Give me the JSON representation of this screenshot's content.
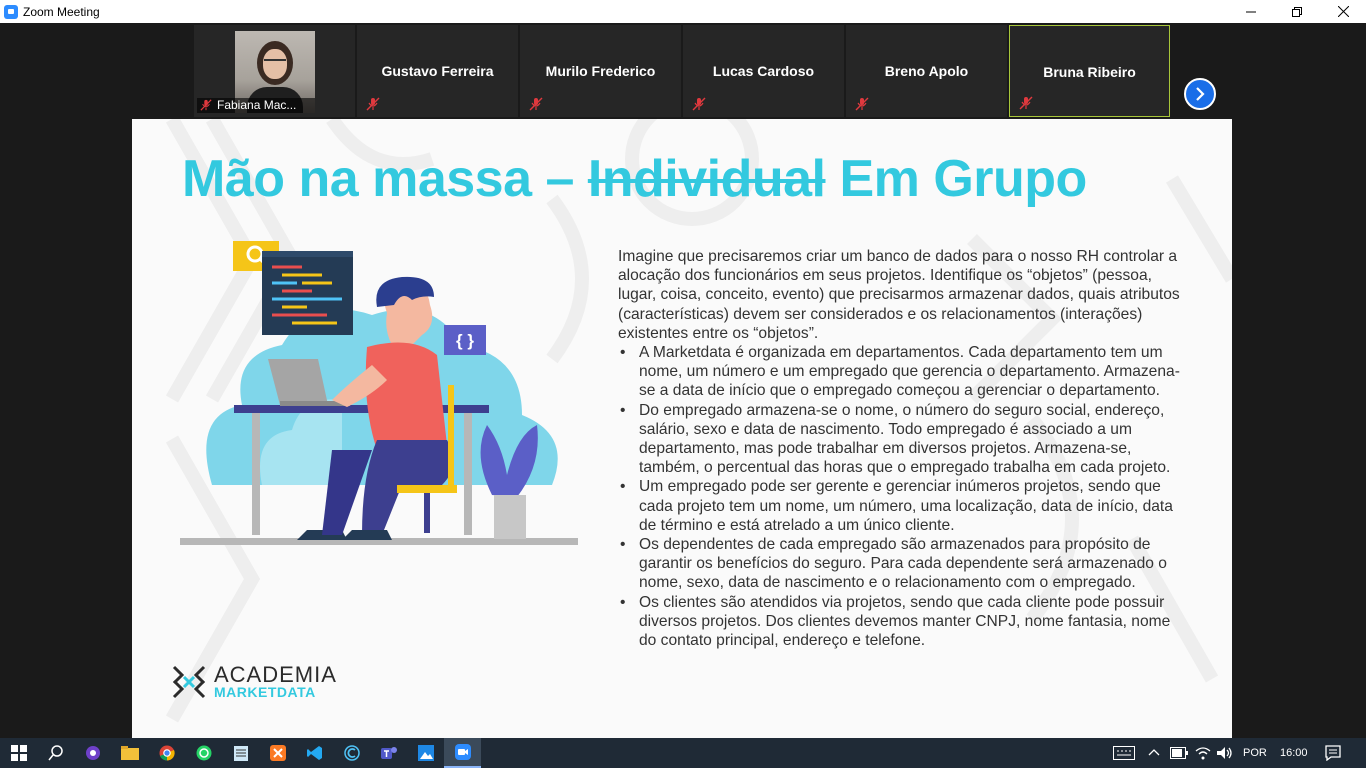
{
  "window": {
    "title": "Zoom Meeting"
  },
  "participants": [
    {
      "name": "Fabiana Mac...",
      "type": "video"
    },
    {
      "name": "Gustavo Ferreira"
    },
    {
      "name": "Murilo Frederico"
    },
    {
      "name": "Lucas Cardoso"
    },
    {
      "name": "Breno Apolo"
    },
    {
      "name": "Bruna Ribeiro",
      "active": true
    }
  ],
  "slide": {
    "title_part1": "Mão na massa – ",
    "title_struck": "Individual",
    "title_part2": " Em Grupo",
    "intro": "Imagine que precisaremos criar um banco de dados para o nosso RH controlar a alocação dos funcionários em seus projetos. Identifique os “objetos” (pessoa, lugar, coisa, conceito, evento) que precisarmos armazenar dados, quais atributos  (características) devem ser considerados e os relacionamentos (interações) existentes entre os “objetos”.",
    "bullets": [
      "A Marketdata é organizada em departamentos. Cada departamento tem um nome, um número e um empregado que gerencia o departamento. Armazena-se a data de início que o empregado começou a gerenciar o departamento.",
      "Do empregado armazena-se o nome, o número do seguro social, endereço, salário, sexo e data de nascimento. Todo empregado é associado a um departamento, mas pode trabalhar em diversos projetos. Armazena-se, também, o percentual das horas que o empregado trabalha em cada projeto.",
      "Um empregado pode ser gerente e gerenciar inúmeros projetos, sendo que cada projeto tem um nome, um número, uma localização, data de início, data de término e está atrelado a um único cliente.",
      "Os dependentes de cada empregado são armazenados para propósito de garantir os benefícios do seguro. Para cada dependente será armazenado o nome, sexo, data de nascimento e o relacionamento com o empregado.",
      "Os clientes são atendidos via projetos, sendo que cada cliente pode possuir diversos projetos. Dos clientes devemos manter CNPJ, nome fantasia, nome do contato principal, endereço e telefone."
    ],
    "logo_line1": "ACADEMIA",
    "logo_line2": "MARKETDATA",
    "braces_label": "{ }"
  },
  "taskbar": {
    "language": "POR",
    "time": "16:00"
  },
  "colors": {
    "accent_cyan": "#33c9df",
    "zoom_blue": "#2d8cff",
    "active_speaker_border": "#a8c63a",
    "muted_red": "#e0393e"
  }
}
